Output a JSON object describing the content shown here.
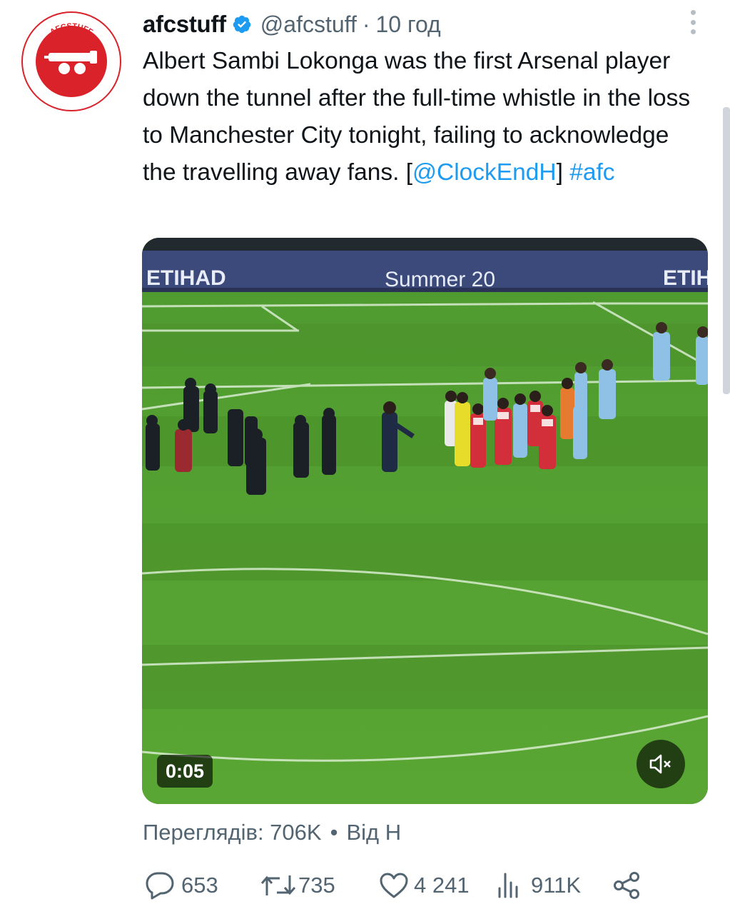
{
  "author": {
    "name": "afcstuff",
    "handle": "@afcstuff",
    "separator": "·",
    "time": "10 год",
    "avatar_text_top": "AFCSTUFF",
    "avatar_text_bottom": "AFCSTUFF"
  },
  "tweet": {
    "text_main": "Albert Sambi Lokonga was the first Arsenal player down the tunnel after the full-time whistle in the loss to Manchester City tonight, failing to acknowledge the travelling away fans. [",
    "mention": "@ClockEndH",
    "text_after_mention": "] ",
    "hashtag": "#afc"
  },
  "media": {
    "duration": "0:05",
    "mute_icon": "speaker-muted-icon",
    "ad_boards": [
      "ETIHAD",
      "Summer 20",
      "ETIHAD"
    ]
  },
  "stats": {
    "views_label": "Переглядів: 706K",
    "separator": "•",
    "source_label": "Від Н"
  },
  "actions": {
    "replies": "653",
    "retweets": "735",
    "likes": "4 241",
    "views": "911K"
  },
  "colors": {
    "accent": "#1d9bf0",
    "secondary_text": "#536471",
    "brand_red": "#d9222a",
    "pitch_green": "#4f9a2e"
  }
}
